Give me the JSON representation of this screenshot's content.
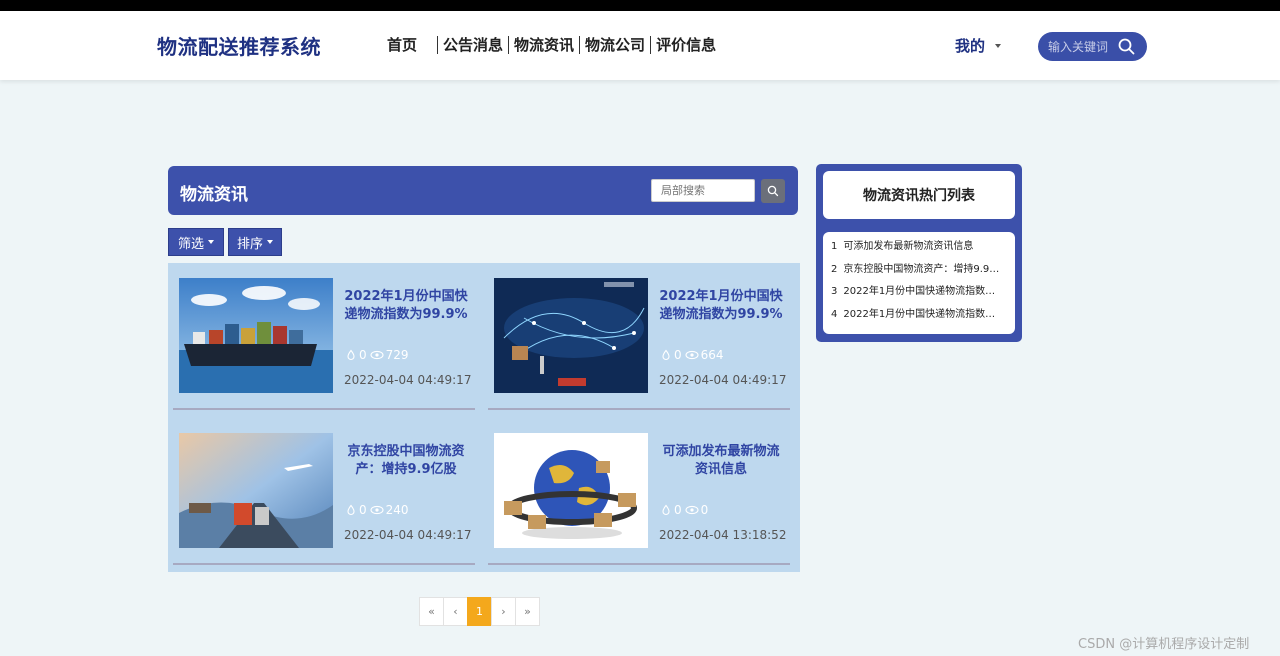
{
  "header": {
    "logo": "物流配送推荐系统",
    "nav": [
      "首页",
      "公告消息",
      "物流资讯",
      "物流公司",
      "评价信息"
    ],
    "mine_label": "我的",
    "search_placeholder": "输入关键词"
  },
  "panel": {
    "title": "物流资讯",
    "local_search_placeholder": "局部搜索",
    "filter_label": "筛选",
    "sort_label": "排序"
  },
  "cards": [
    {
      "title": "2022年1月份中国快递物流指数为99.9%",
      "likes": "0",
      "views": "729",
      "date": "2022-04-04 04:49:17",
      "image": "cargo-ship-image"
    },
    {
      "title": "2022年1月份中国快递物流指数为99.9%",
      "likes": "0",
      "views": "664",
      "date": "2022-04-04 04:49:17",
      "image": "global-network-image"
    },
    {
      "title": "京东控股中国物流资产：增持9.9亿股 持…",
      "likes": "0",
      "views": "240",
      "date": "2022-04-04 04:49:17",
      "image": "transport-collage-image"
    },
    {
      "title": "可添加发布最新物流资讯信息",
      "likes": "0",
      "views": "0",
      "date": "2022-04-04 13:18:52",
      "image": "globe-boxes-image"
    }
  ],
  "pager": [
    "«",
    "‹",
    "1",
    "›",
    "»"
  ],
  "hot": {
    "title": "物流资讯热门列表",
    "items": [
      {
        "num": "1",
        "text": "可添加发布最新物流资讯信息"
      },
      {
        "num": "2",
        "text": "京东控股中国物流资产：增持9.9…"
      },
      {
        "num": "3",
        "text": "2022年1月份中国快递物流指数…"
      },
      {
        "num": "4",
        "text": "2022年1月份中国快递物流指数…"
      }
    ]
  },
  "watermark": "CSDN @计算机程序设计定制",
  "colors": {
    "brand": "#3d51ab",
    "logo": "#1f3182",
    "active_page": "#f4a81c",
    "grid_bg": "#bed8ee"
  }
}
